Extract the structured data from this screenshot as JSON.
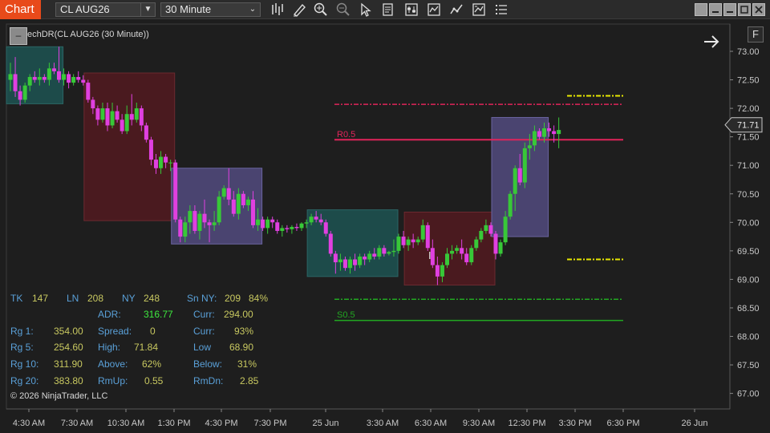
{
  "toolbar": {
    "chart_tab": "Chart",
    "instrument": "CL AUG26",
    "interval": "30 Minute",
    "icons": [
      "bar-type-icon",
      "draw-icon",
      "zoom-in-icon",
      "zoom-out-icon",
      "pointer-icon",
      "data-box-icon",
      "properties-icon",
      "indicators-icon",
      "strategies-icon",
      "templates-icon",
      "more-icon"
    ],
    "window_buttons": [
      "minimize",
      "maximize",
      "close"
    ]
  },
  "chart": {
    "indicator_label": "echDR(CL AUG26 (30 Minute))",
    "collapse_label": "–",
    "f_label": "F",
    "current_price": "71.71",
    "r_label": "R0.5",
    "s_label": "S0.5",
    "colors": {
      "background": "#1e1e1e",
      "up": "#38c838",
      "down": "#e040e0",
      "box_teal": "#1d4b4a",
      "box_maroon": "#4a1a1f",
      "box_lavender": "#4a4470",
      "resistance": "#e0245a",
      "support": "#22a822",
      "yellow": "#e8e800"
    },
    "copyright": "© 2026 NinjaTrader, LLC"
  },
  "stats": {
    "tk_label": "TK",
    "tk_value": "147",
    "ln_label": "LN",
    "ln_value": "208",
    "ny_label": "NY",
    "ny_value": "248",
    "snny_label": "Sn NY:",
    "snny_value": "209",
    "snny_pct": "84%",
    "adr_label": "ADR:",
    "adr_value": "316.77",
    "curr1_label": "Curr:",
    "curr1_value": "294.00",
    "rg1_label": "Rg  1:",
    "rg1_value": "354.00",
    "spread_label": "Spread:",
    "spread_value": "0",
    "curr2_label": "Curr:",
    "curr2_value": "93%",
    "rg5_label": "Rg  5:",
    "rg5_value": "254.60",
    "high_label": "High:",
    "high_value": "71.84",
    "low_label": "Low",
    "low_value": "68.90",
    "rg10_label": "Rg 10:",
    "rg10_value": "311.90",
    "above_label": "Above:",
    "above_value": "62%",
    "below_label": "Below:",
    "below_value": "31%",
    "rg20_label": "Rg 20:",
    "rg20_value": "383.80",
    "rmup_label": "RmUp:",
    "rmup_value": "0.55",
    "rmdn_label": "RmDn:",
    "rmdn_value": "2.85"
  },
  "chart_data": {
    "type": "candlestick",
    "instrument": "CL AUG26",
    "interval": "30 Minute",
    "y_ticks": [
      73.0,
      72.5,
      72.0,
      71.5,
      71.0,
      70.5,
      70.0,
      69.5,
      69.0,
      68.5,
      68.0,
      67.5,
      67.0
    ],
    "x_ticks": [
      "4:30 AM",
      "7:30 AM",
      "10:30 AM",
      "1:30 PM",
      "4:30 PM",
      "7:30 PM",
      "25 Jun",
      "3:30 AM",
      "6:30 AM",
      "9:30 AM",
      "12:30 PM",
      "3:30 PM",
      "6:30 PM",
      "26 Jun"
    ],
    "levels": {
      "r_upper": 72.07,
      "r05": 71.45,
      "yellow_top": 72.22,
      "yellow_bottom": 69.35,
      "s_upper": 68.65,
      "s05": 68.28,
      "current": 71.71
    },
    "session_boxes": [
      {
        "kind": "teal",
        "start_bar": 0,
        "end_bar": 11,
        "high": 73.08,
        "low": 72.08
      },
      {
        "kind": "maroon",
        "start_bar": 16,
        "end_bar": 34,
        "high": 72.62,
        "low": 70.03
      },
      {
        "kind": "lavender",
        "start_bar": 34,
        "end_bar": 52,
        "high": 70.95,
        "low": 69.62
      },
      {
        "kind": "teal",
        "start_bar": 62,
        "end_bar": 80,
        "high": 70.22,
        "low": 69.05
      },
      {
        "kind": "maroon",
        "start_bar": 82,
        "end_bar": 100,
        "high": 70.18,
        "low": 68.9
      },
      {
        "kind": "lavender",
        "start_bar": 100,
        "end_bar": 111,
        "high": 71.84,
        "low": 69.75
      }
    ],
    "bars": [
      [
        72.5,
        72.8,
        72.3,
        72.6
      ],
      [
        72.6,
        72.9,
        72.2,
        72.3
      ],
      [
        72.3,
        72.4,
        72.05,
        72.15
      ],
      [
        72.15,
        72.45,
        72.1,
        72.4
      ],
      [
        72.4,
        72.6,
        72.3,
        72.55
      ],
      [
        72.55,
        72.65,
        72.45,
        72.5
      ],
      [
        72.5,
        72.7,
        72.4,
        72.55
      ],
      [
        72.55,
        72.6,
        72.45,
        72.5
      ],
      [
        72.5,
        72.8,
        72.4,
        72.7
      ],
      [
        72.7,
        72.8,
        72.6,
        72.65
      ],
      [
        72.65,
        73.08,
        72.45,
        72.5
      ],
      [
        72.5,
        72.7,
        72.4,
        72.6
      ],
      [
        72.6,
        72.65,
        72.35,
        72.45
      ],
      [
        72.45,
        72.6,
        72.4,
        72.55
      ],
      [
        72.55,
        72.65,
        72.45,
        72.5
      ],
      [
        72.5,
        72.58,
        72.4,
        72.45
      ],
      [
        72.45,
        72.5,
        72.1,
        72.15
      ],
      [
        72.15,
        72.2,
        71.9,
        72.0
      ],
      [
        72.0,
        72.05,
        71.7,
        71.8
      ],
      [
        71.8,
        72.1,
        71.75,
        72.0
      ],
      [
        72.0,
        72.1,
        71.6,
        71.7
      ],
      [
        71.7,
        72.1,
        71.65,
        71.95
      ],
      [
        71.95,
        72.05,
        71.75,
        71.8
      ],
      [
        71.8,
        71.9,
        71.55,
        71.6
      ],
      [
        71.6,
        72.05,
        71.55,
        71.9
      ],
      [
        71.9,
        72.25,
        71.7,
        71.8
      ],
      [
        71.8,
        72.1,
        71.75,
        72.0
      ],
      [
        72.0,
        72.05,
        71.6,
        71.7
      ],
      [
        71.7,
        71.75,
        71.4,
        71.45
      ],
      [
        71.45,
        71.5,
        71.0,
        71.1
      ],
      [
        71.1,
        71.2,
        70.85,
        70.95
      ],
      [
        70.95,
        71.25,
        70.85,
        71.15
      ],
      [
        71.15,
        71.2,
        70.95,
        71.05
      ],
      [
        71.05,
        71.1,
        70.9,
        71.05
      ],
      [
        71.05,
        71.1,
        70.0,
        70.05
      ],
      [
        70.05,
        70.1,
        69.65,
        69.75
      ],
      [
        69.75,
        70.1,
        69.65,
        70.0
      ],
      [
        70.0,
        70.3,
        69.8,
        70.2
      ],
      [
        70.2,
        70.3,
        69.8,
        69.85
      ],
      [
        69.85,
        70.2,
        69.7,
        70.15
      ],
      [
        70.15,
        70.4,
        69.9,
        70.0
      ],
      [
        70.0,
        70.05,
        69.65,
        69.95
      ],
      [
        69.95,
        70.2,
        69.85,
        70.0
      ],
      [
        70.0,
        70.55,
        69.95,
        70.45
      ],
      [
        70.45,
        70.65,
        70.4,
        70.6
      ],
      [
        70.6,
        70.95,
        70.3,
        70.4
      ],
      [
        70.4,
        70.55,
        70.1,
        70.15
      ],
      [
        70.15,
        70.6,
        70.05,
        70.5
      ],
      [
        70.5,
        70.55,
        70.25,
        70.3
      ],
      [
        70.3,
        70.45,
        70.2,
        70.4
      ],
      [
        70.4,
        70.55,
        69.9,
        69.95
      ],
      [
        69.95,
        70.25,
        69.85,
        70.05
      ],
      [
        70.05,
        70.1,
        69.85,
        69.9
      ],
      [
        69.9,
        70.1,
        69.8,
        70.05
      ],
      [
        70.05,
        70.1,
        69.9,
        70.0
      ],
      [
        70.0,
        70.05,
        69.8,
        69.85
      ],
      [
        69.85,
        69.95,
        69.75,
        69.9
      ],
      [
        69.9,
        69.95,
        69.82,
        69.88
      ],
      [
        69.88,
        69.95,
        69.8,
        69.92
      ],
      [
        69.92,
        69.98,
        69.85,
        69.9
      ],
      [
        69.9,
        70.0,
        69.85,
        69.98
      ],
      [
        69.98,
        70.05,
        69.9,
        70.0
      ],
      [
        70.0,
        70.15,
        69.95,
        70.1
      ],
      [
        70.1,
        70.2,
        70.0,
        70.05
      ],
      [
        70.05,
        70.15,
        69.95,
        70.0
      ],
      [
        70.0,
        70.05,
        69.75,
        69.8
      ],
      [
        69.8,
        69.85,
        69.4,
        69.45
      ],
      [
        69.45,
        69.5,
        69.1,
        69.3
      ],
      [
        69.3,
        69.45,
        69.15,
        69.35
      ],
      [
        69.35,
        69.4,
        69.15,
        69.2
      ],
      [
        69.2,
        69.4,
        69.1,
        69.35
      ],
      [
        69.35,
        69.45,
        69.15,
        69.25
      ],
      [
        69.25,
        69.45,
        69.2,
        69.4
      ],
      [
        69.4,
        69.45,
        69.25,
        69.35
      ],
      [
        69.35,
        69.5,
        69.3,
        69.45
      ],
      [
        69.45,
        69.55,
        69.35,
        69.4
      ],
      [
        69.4,
        69.6,
        69.35,
        69.55
      ],
      [
        69.55,
        69.6,
        69.4,
        69.45
      ],
      [
        69.45,
        69.5,
        69.42,
        69.48
      ],
      [
        69.48,
        69.7,
        69.4,
        69.5
      ],
      [
        69.5,
        69.8,
        69.45,
        69.75
      ],
      [
        69.75,
        69.85,
        69.55,
        69.6
      ],
      [
        69.6,
        69.75,
        69.5,
        69.7
      ],
      [
        69.7,
        69.8,
        69.55,
        69.65
      ],
      [
        69.65,
        69.75,
        69.6,
        69.7
      ],
      [
        69.7,
        70.05,
        69.65,
        69.95
      ],
      [
        69.95,
        70.0,
        69.5,
        69.55
      ],
      [
        69.55,
        69.7,
        69.2,
        69.25
      ],
      [
        69.25,
        69.4,
        68.9,
        69.05
      ],
      [
        69.05,
        69.3,
        68.95,
        69.25
      ],
      [
        69.25,
        69.55,
        69.2,
        69.45
      ],
      [
        69.45,
        69.6,
        69.35,
        69.5
      ],
      [
        69.5,
        69.6,
        69.45,
        69.55
      ],
      [
        69.55,
        69.7,
        69.35,
        69.45
      ],
      [
        69.45,
        69.55,
        69.25,
        69.3
      ],
      [
        69.3,
        69.6,
        69.25,
        69.55
      ],
      [
        69.55,
        69.75,
        69.5,
        69.7
      ],
      [
        69.7,
        69.9,
        69.65,
        69.85
      ],
      [
        69.85,
        70.05,
        69.8,
        69.95
      ],
      [
        69.95,
        70.0,
        69.75,
        69.8
      ],
      [
        69.8,
        69.85,
        69.35,
        69.45
      ],
      [
        69.45,
        69.7,
        69.4,
        69.65
      ],
      [
        69.65,
        70.2,
        69.6,
        70.1
      ],
      [
        70.1,
        70.55,
        70.05,
        70.5
      ],
      [
        70.5,
        71.0,
        70.2,
        70.95
      ],
      [
        70.95,
        71.2,
        70.65,
        70.7
      ],
      [
        70.7,
        71.4,
        70.6,
        71.3
      ],
      [
        71.3,
        71.55,
        71.1,
        71.35
      ],
      [
        71.35,
        71.7,
        71.25,
        71.6
      ],
      [
        71.6,
        71.65,
        71.45,
        71.5
      ],
      [
        71.5,
        71.75,
        71.4,
        71.65
      ],
      [
        71.65,
        71.75,
        71.5,
        71.6
      ],
      [
        71.6,
        71.7,
        71.4,
        71.55
      ],
      [
        71.55,
        71.84,
        71.3,
        71.62
      ]
    ]
  }
}
